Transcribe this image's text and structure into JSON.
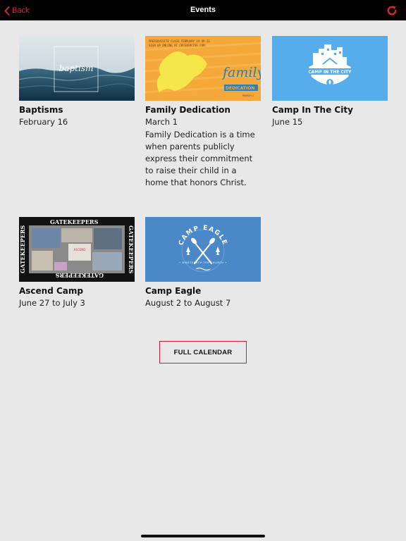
{
  "nav": {
    "back_label": "Back",
    "title": "Events",
    "back_icon": "chevron-left-icon",
    "refresh_icon": "refresh-icon",
    "accent": "#e0242e"
  },
  "events": [
    {
      "title": "Baptisms",
      "date": "February 16",
      "thumb_text": "baptism"
    },
    {
      "title": "Family Dedication",
      "date": "March 1",
      "description": "Family Dedication is a time when parents publicly express their commitment to raise their child in a home that honors Christ.",
      "thumb_text": "family",
      "thumb_sub": "DEDICATION",
      "thumb_top_line1": "PREREQUISITE CLASS FEBRUARY 19 OR 22",
      "thumb_top_line2": "SIGN UP ONLINE AT CRCEXERCISE.COM",
      "thumb_date": "MARCH 1"
    },
    {
      "title": "Camp In The City",
      "date": "June 15",
      "thumb_text": "CAMP IN THE CITY"
    },
    {
      "title": "Ascend Camp",
      "date": "June 27 to July 3",
      "thumb_text": "GATEKEEPERS"
    },
    {
      "title": "Camp Eagle",
      "date": "August 2 to August 7",
      "thumb_text": "CAMP EAGLE"
    }
  ],
  "full_calendar_label": "FULL CALENDAR"
}
